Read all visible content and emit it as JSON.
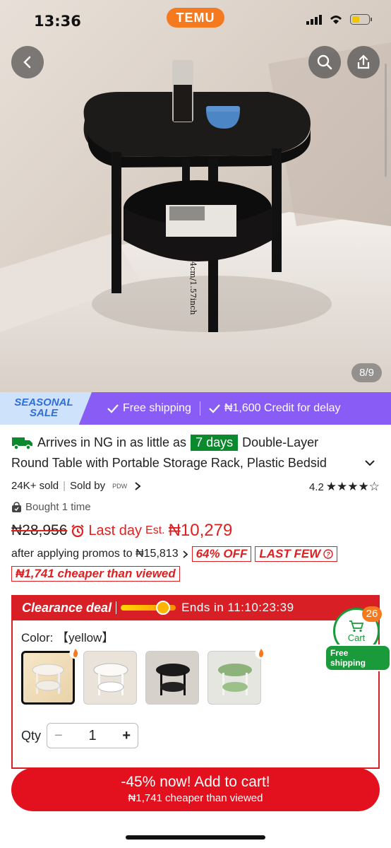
{
  "status": {
    "time": "13:36",
    "app_badge": "TEMU"
  },
  "gallery": {
    "pager": "8/9",
    "dim_label": "4cm/1.57inch"
  },
  "promo": {
    "seasonal_line1": "SEASONAL",
    "seasonal_line2": "SALE",
    "free_shipping": "Free shipping",
    "credit": "₦1,600 Credit for delay"
  },
  "product": {
    "arrives": "Arrives in NG in as little as",
    "days": "7 days",
    "title_start": "Double-Layer",
    "title_line2": "Round Table with Portable Storage Rack, Plastic Bedsid",
    "sold": "24K+ sold",
    "sold_by": "Sold by",
    "seller": "PDW",
    "rating": "4.2",
    "stars": "★★★★☆",
    "bought": "Bought 1 time"
  },
  "price": {
    "old": "₦28,956",
    "last_day": "Last day",
    "est": "Est.",
    "est_value": "₦10,279",
    "after_promo": "after applying promos to ₦15,813",
    "off_tag": "64% OFF",
    "last_few": "LAST FEW",
    "cheaper": "₦1,741 cheaper than viewed"
  },
  "clearance": {
    "label": "Clearance deal",
    "ends": "Ends in 11:10:23:39"
  },
  "options": {
    "color_label": "Color:",
    "color_value": "【yellow】",
    "qty_label": "Qty",
    "qty_value": "1"
  },
  "cart": {
    "label": "Cart",
    "count": "26",
    "free_shipping": "Free shipping"
  },
  "add_to_cart": {
    "main": "-45% now! Add to cart!",
    "sub": "₦1,741 cheaper than viewed"
  },
  "colors": {
    "accent": "#e3101e",
    "promo_purple": "#8a5cf6",
    "green": "#0a8a2c",
    "temu_orange": "#f57a1f"
  }
}
